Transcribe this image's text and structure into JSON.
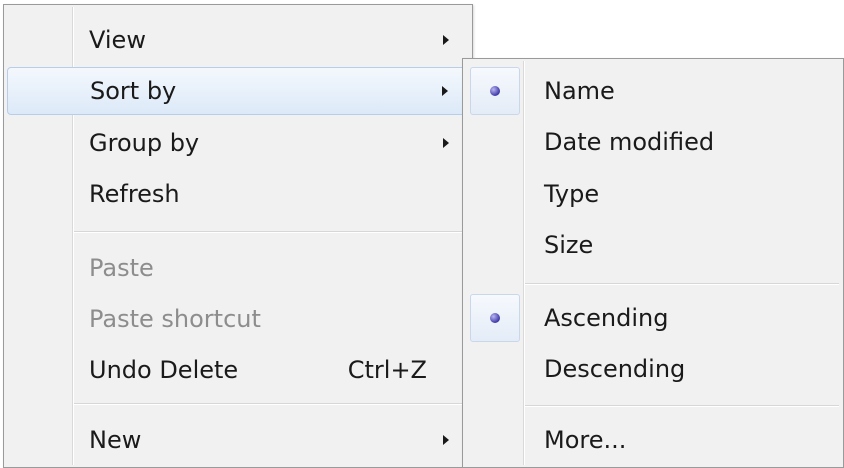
{
  "context_menu": {
    "items": [
      {
        "label": "View",
        "has_submenu": true
      },
      {
        "label": "Sort by",
        "has_submenu": true,
        "highlighted": true
      },
      {
        "label": "Group by",
        "has_submenu": true
      },
      {
        "label": "Refresh"
      },
      {
        "label": "Paste",
        "disabled": true
      },
      {
        "label": "Paste shortcut",
        "disabled": true
      },
      {
        "label": "Undo Delete",
        "shortcut": "Ctrl+Z"
      },
      {
        "label": "New",
        "has_submenu": true
      }
    ]
  },
  "sort_submenu": {
    "items": [
      {
        "label": "Name",
        "selected": true
      },
      {
        "label": "Date modified"
      },
      {
        "label": "Type"
      },
      {
        "label": "Size"
      },
      {
        "label": "Ascending",
        "selected": true
      },
      {
        "label": "Descending"
      },
      {
        "label": "More..."
      }
    ]
  },
  "colors": {
    "highlight_border": "#b7cde9",
    "radio_dot": "#3d37a8",
    "disabled_text": "#8d8d8d"
  }
}
